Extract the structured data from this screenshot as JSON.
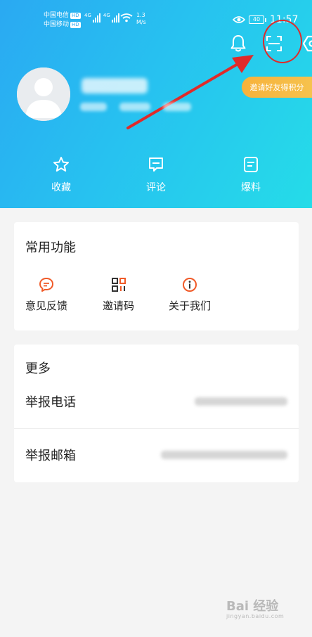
{
  "status_bar": {
    "carrier1": "中国电信",
    "carrier2": "中国移动",
    "hd_badge": "HD",
    "net_type": "4G",
    "speed_value": "1.3",
    "speed_unit": "M/s",
    "battery": "40",
    "time": "11:57"
  },
  "header": {
    "icons": [
      "bell-icon",
      "scan-icon",
      "settings-icon"
    ],
    "invite_badge": "邀请好友得积分",
    "actions": [
      {
        "label": "收藏",
        "icon": "star-icon"
      },
      {
        "label": "评论",
        "icon": "comment-icon"
      },
      {
        "label": "爆料",
        "icon": "document-icon"
      }
    ]
  },
  "common": {
    "title": "常用功能",
    "items": [
      {
        "label": "意见反馈",
        "icon": "feedback-icon"
      },
      {
        "label": "邀请码",
        "icon": "qrcode-icon"
      },
      {
        "label": "关于我们",
        "icon": "info-icon"
      }
    ]
  },
  "more": {
    "title": "更多",
    "rows": [
      {
        "label": "举报电话"
      },
      {
        "label": "举报邮箱"
      }
    ]
  },
  "watermark": {
    "brand": "Bai 经验",
    "url": "jingyan.baidu.com"
  },
  "colors": {
    "header_gradient_start": "#2aa9f2",
    "header_gradient_end": "#25dce8",
    "badge": "#f7b23b",
    "icon_orange": "#f05a28",
    "annotation_red": "#e02a2a"
  }
}
